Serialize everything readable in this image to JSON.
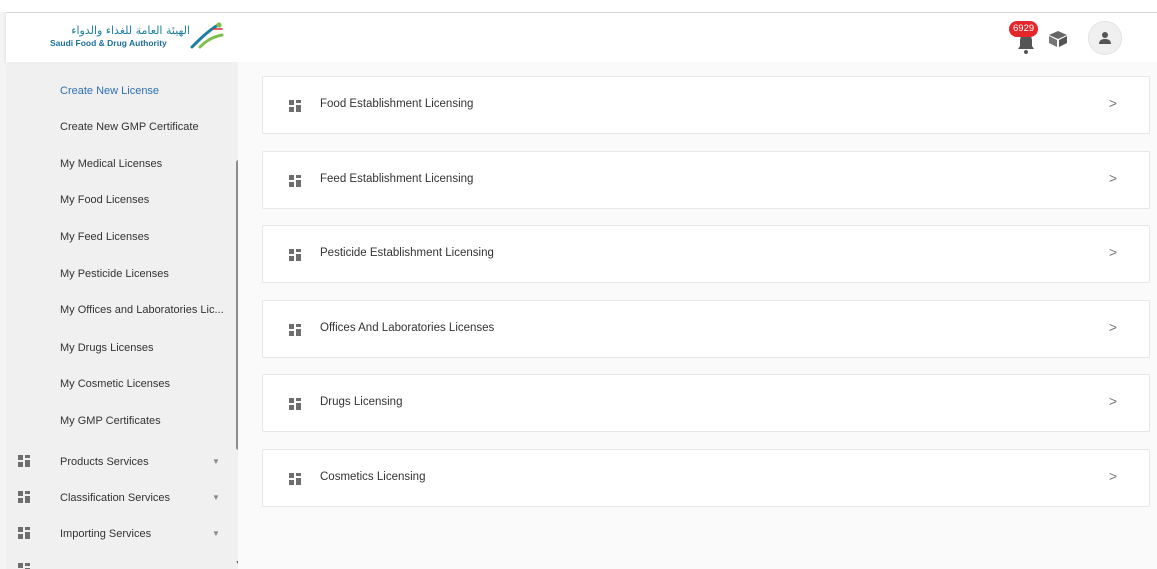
{
  "header": {
    "logo_ar": "الهيئة العامة للغذاء والدواء",
    "logo_en": "Saudi Food & Drug Authority",
    "notification_count": "6929",
    "colors": {
      "badge": "#e4262a",
      "accent": "#2d6fb5",
      "logo_green": "#7cc04b",
      "logo_blue": "#1c7fa0"
    }
  },
  "sidebar": {
    "sub_items": [
      {
        "label": "Create New License",
        "active": true
      },
      {
        "label": "Create New GMP Certificate"
      },
      {
        "label": "My Medical Licenses"
      },
      {
        "label": "My Food Licenses"
      },
      {
        "label": "My Feed Licenses"
      },
      {
        "label": "My Pesticide Licenses"
      },
      {
        "label": "My Offices and Laboratories Lic..."
      },
      {
        "label": "My Drugs Licenses"
      },
      {
        "label": "My Cosmetic Licenses"
      },
      {
        "label": "My GMP Certificates"
      }
    ],
    "services": [
      {
        "label": "Products Services",
        "icon": "grid-icon"
      },
      {
        "label": "Classification Services",
        "icon": "grid-icon"
      },
      {
        "label": "Importing Services",
        "icon": "grid-icon"
      }
    ]
  },
  "main": {
    "cards": [
      {
        "label": "Food Establishment Licensing",
        "icon": "grid-icon"
      },
      {
        "label": "Feed Establishment Licensing",
        "icon": "grid-icon"
      },
      {
        "label": "Pesticide Establishment Licensing",
        "icon": "grid-icon"
      },
      {
        "label": "Offices And Laboratories Licenses",
        "icon": "grid-icon"
      },
      {
        "label": "Drugs Licensing",
        "icon": "grid-icon"
      },
      {
        "label": "Cosmetics Licensing",
        "icon": "grid-icon"
      }
    ],
    "chevron": ">"
  }
}
